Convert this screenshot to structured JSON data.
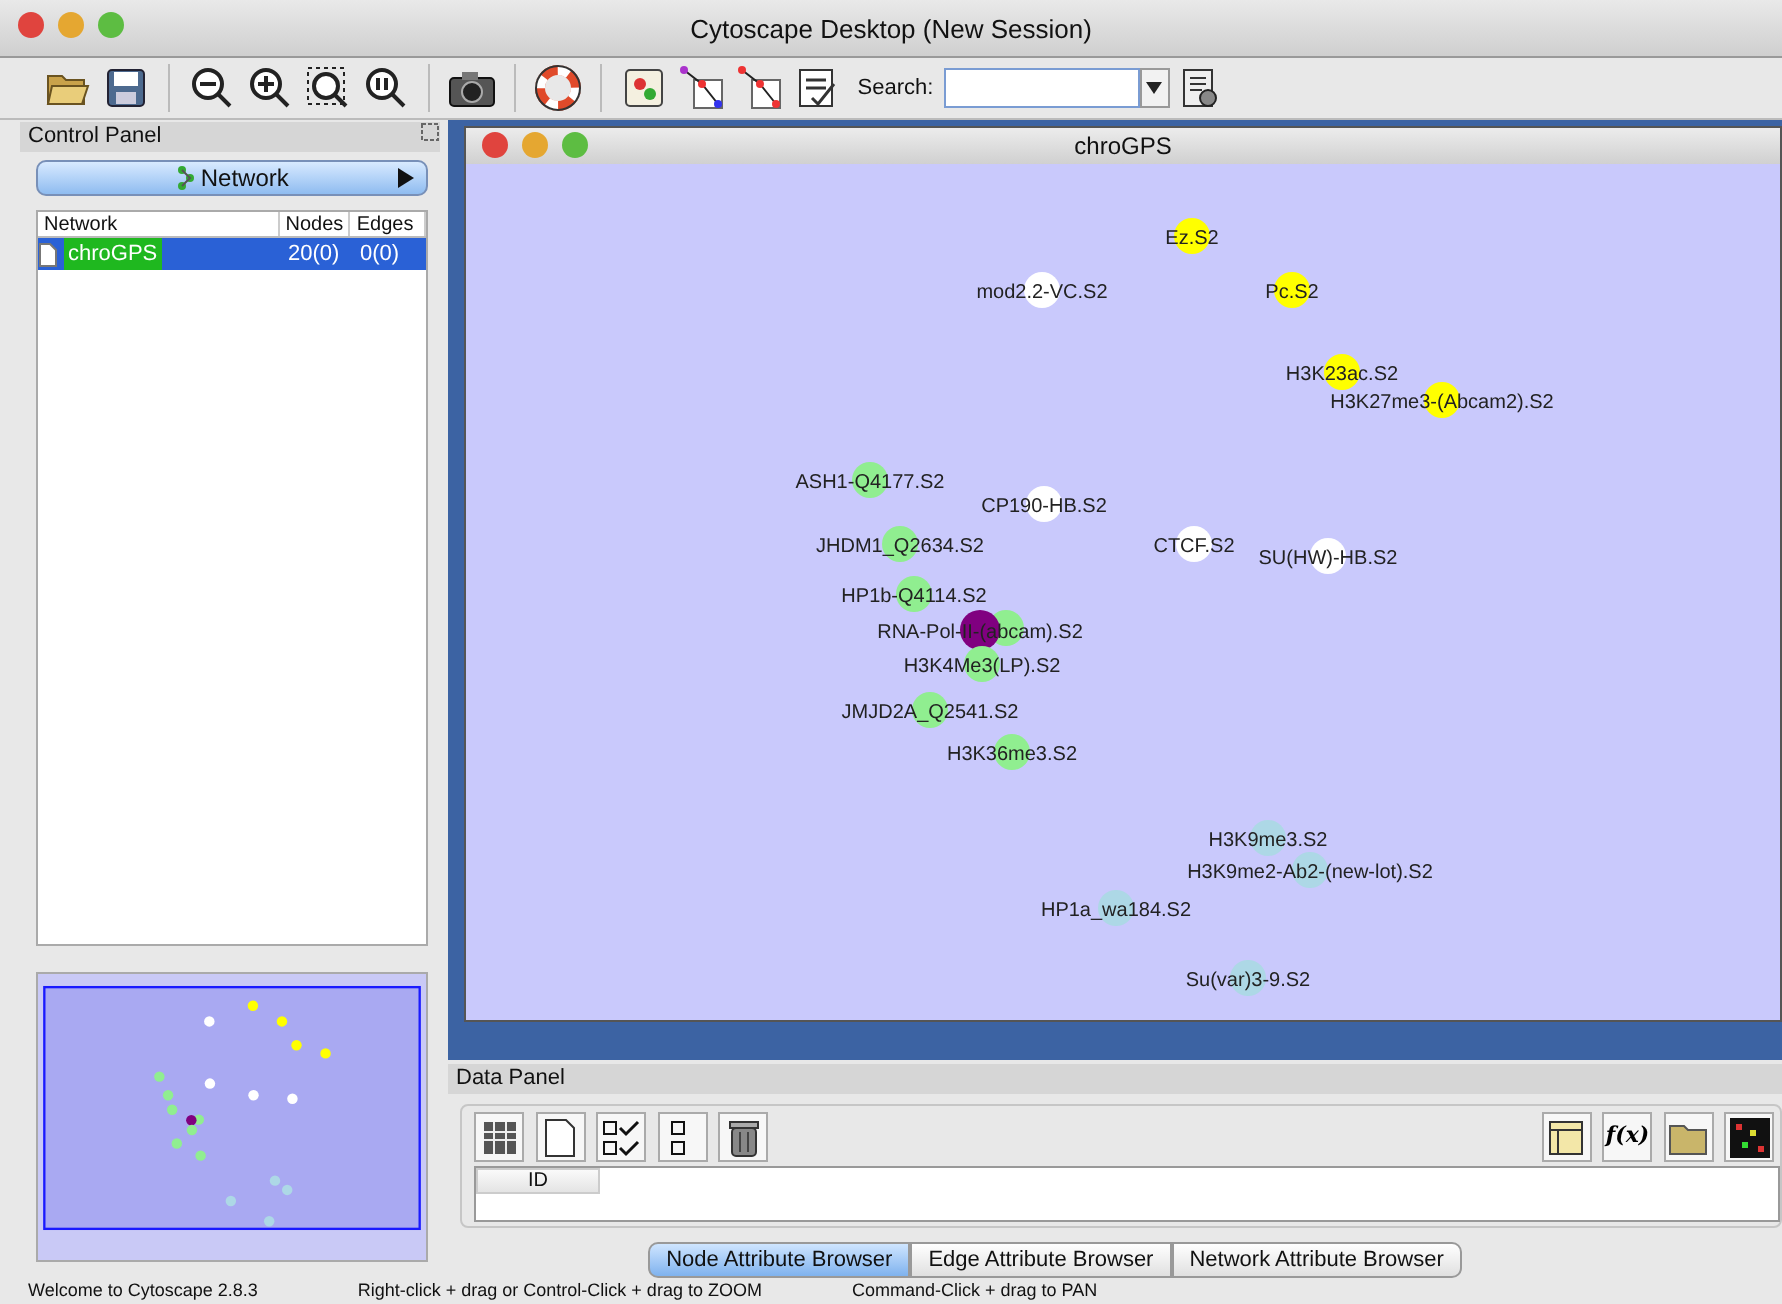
{
  "window": {
    "title": "Cytoscape Desktop (New Session)"
  },
  "toolbar": {
    "search_label": "Search:"
  },
  "control_panel": {
    "title": "Control Panel",
    "tab": "Network",
    "table": {
      "columns": [
        "Network",
        "Nodes",
        "Edges"
      ],
      "rows": [
        {
          "name": "chroGPS",
          "nodes": "20(0)",
          "edges": "0(0)",
          "selected": true
        }
      ]
    }
  },
  "network_window": {
    "title": "chroGPS",
    "nodes": [
      {
        "label": "Ez.S2",
        "color": "#ffff00"
      },
      {
        "label": "mod2.2-VC.S2",
        "color": "#ffffff"
      },
      {
        "label": "Pc.S2",
        "color": "#ffff00"
      },
      {
        "label": "H3K23ac.S2",
        "color": "#ffff00"
      },
      {
        "label": "H3K27me3-(Abcam2).S2",
        "color": "#ffff00"
      },
      {
        "label": "ASH1-Q4177.S2",
        "color": "#90ee90"
      },
      {
        "label": "CP190-HB.S2",
        "color": "#ffffff"
      },
      {
        "label": "JHDM1_Q2634.S2",
        "color": "#90ee90"
      },
      {
        "label": "CTCF.S2",
        "color": "#ffffff"
      },
      {
        "label": "SU(HW)-HB.S2",
        "color": "#ffffff"
      },
      {
        "label": "HP1b-Q4114.S2",
        "color": "#90ee90"
      },
      {
        "color": "#90ee90"
      },
      {
        "label": "RNA-Pol-II-(abcam).S2",
        "color": "#800080"
      },
      {
        "label": "H3K4Me3(LP).S2",
        "color": "#90ee90"
      },
      {
        "label": "JMJD2A_Q2541.S2",
        "color": "#90ee90"
      },
      {
        "label": "H3K36me3.S2",
        "color": "#90ee90"
      },
      {
        "label": "H3K9me3.S2",
        "color": "#add8e6"
      },
      {
        "label": "H3K9me2-Ab2-(new-lot).S2",
        "color": "#add8e6"
      },
      {
        "label": "HP1a_wa184.S2",
        "color": "#add8e6"
      },
      {
        "label": "Su(var)3-9.S2",
        "color": "#add8e6"
      }
    ]
  },
  "data_panel": {
    "title": "Data Panel",
    "function_button": "f(x)",
    "columns": [
      "ID"
    ],
    "tabs": [
      {
        "label": "Node Attribute Browser",
        "selected": true
      },
      {
        "label": "Edge Attribute Browser",
        "selected": false
      },
      {
        "label": "Network Attribute Browser",
        "selected": false
      }
    ]
  },
  "status_bar": [
    "Welcome to Cytoscape 2.8.3",
    "Right-click + drag or Control-Click + drag to ZOOM",
    "Command-Click + drag to PAN"
  ]
}
